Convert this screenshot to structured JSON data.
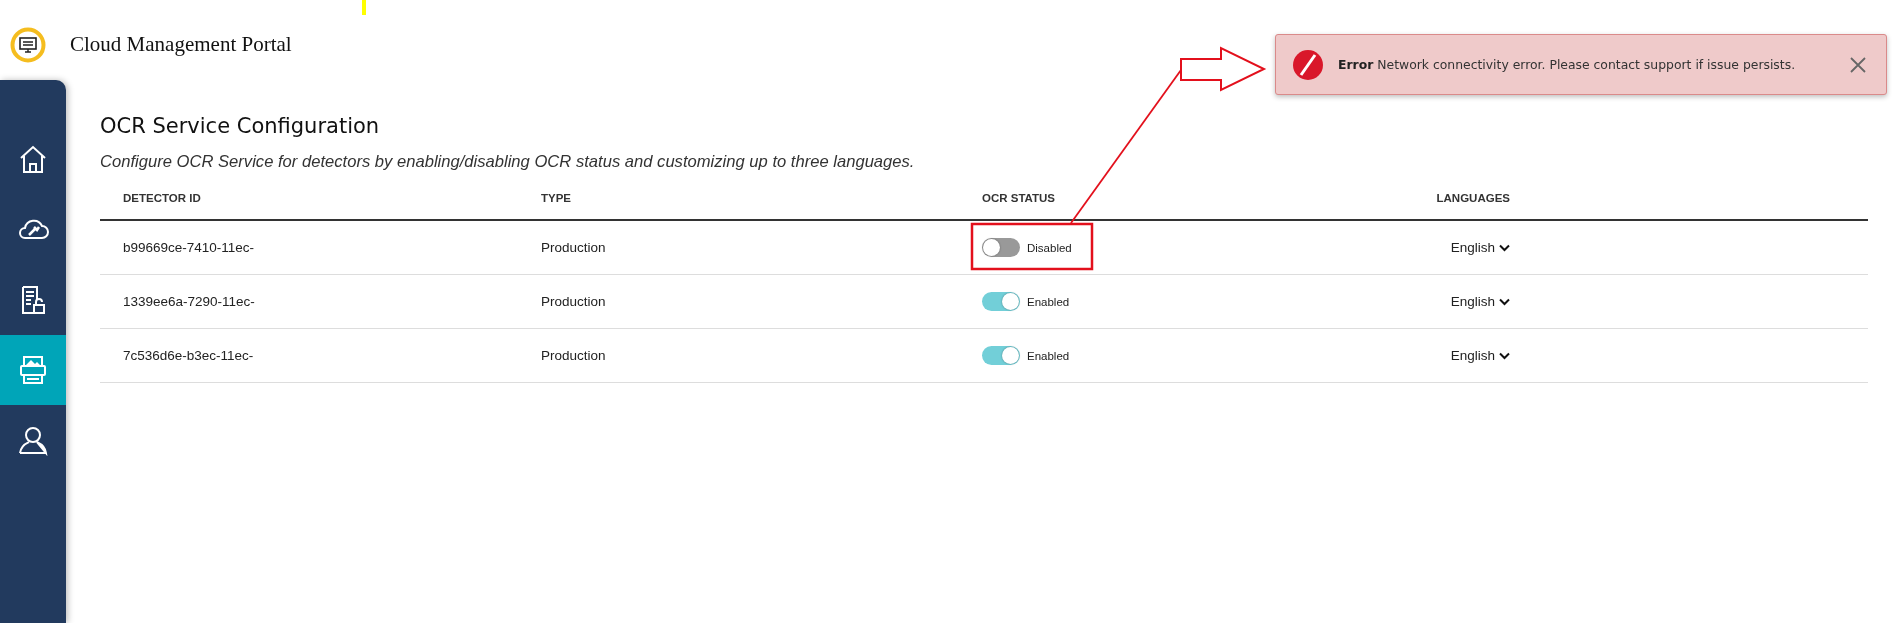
{
  "header": {
    "title": "Cloud Management Portal"
  },
  "sidebar": {
    "items": [
      {
        "selected": false
      },
      {
        "selected": false
      },
      {
        "selected": false
      },
      {
        "selected": true
      },
      {
        "selected": false
      }
    ]
  },
  "page": {
    "title": "OCR Service Configuration",
    "description": "Configure OCR Service for detectors by enabling/disabling OCR status and customizing up to three languages."
  },
  "table": {
    "columns": [
      "DETECTOR ID",
      "TYPE",
      "OCR STATUS",
      "LANGUAGES"
    ],
    "rows": [
      {
        "detector_id": "b99669ce-7410-11ec-",
        "type": "Production",
        "ocr_on": false,
        "ocr_label": "Disabled",
        "language": "English"
      },
      {
        "detector_id": "1339ee6a-7290-11ec-",
        "type": "Production",
        "ocr_on": true,
        "ocr_label": "Enabled",
        "language": "English"
      },
      {
        "detector_id": "7c536d6e-b3ec-11ec-",
        "type": "Production",
        "ocr_on": true,
        "ocr_label": "Enabled",
        "language": "English"
      }
    ]
  },
  "toast": {
    "kind": "error",
    "title": "Error",
    "message": "Network connectivity error. Please contact support if issue persists."
  }
}
